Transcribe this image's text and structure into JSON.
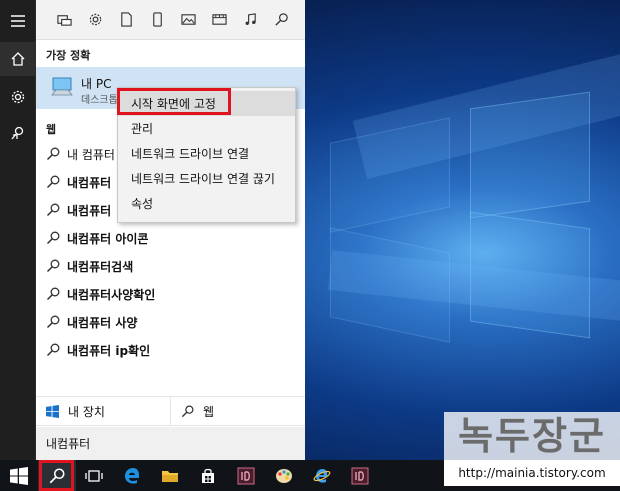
{
  "start_menu": {
    "best_match_label": "가장 정확",
    "best_match": {
      "title": "내 PC",
      "subtitle": "데스크톱 앱"
    },
    "web_label": "웹",
    "web_results": [
      {
        "prefix": "내 컴퓨터 ",
        "bold": ""
      },
      {
        "prefix": "",
        "bold": "내컴퓨터"
      },
      {
        "prefix": "",
        "bold": "내컴퓨터"
      },
      {
        "prefix": "",
        "bold": "내컴퓨터 아이콘"
      },
      {
        "prefix": "",
        "bold": "내컴퓨터검색"
      },
      {
        "prefix": "",
        "bold": "내컴퓨터사양확인"
      },
      {
        "prefix": "",
        "bold": "내컴퓨터 사양"
      },
      {
        "prefix": "",
        "bold": "내컴퓨터 ip확인"
      }
    ],
    "tabs": {
      "my_stuff": "내 장치",
      "web": "웹"
    },
    "search_query": "내컴퓨터"
  },
  "context_menu": {
    "items": [
      "시작 화면에 고정",
      "관리",
      "네트워크 드라이브 연결",
      "네트워크 드라이브 연결 끊기",
      "속성"
    ]
  },
  "watermark": {
    "title": "녹두장군",
    "url": "http://mainia.tistory.com"
  },
  "colors": {
    "highlight": "#cfe3f5",
    "accent_red": "#e0141e",
    "edge_blue": "#1e90e0"
  }
}
